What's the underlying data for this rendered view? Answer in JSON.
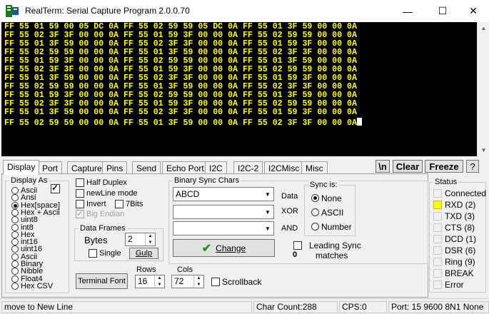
{
  "window": {
    "title": "RealTerm: Serial Capture Program 2.0.0.70",
    "minimize": "—",
    "maximize": "☐",
    "close": "✕"
  },
  "terminal": {
    "text_color": "#ffff00",
    "lines": [
      "FF 55 01 59 00 05 DC 0A FF 55 02 59 59 05 DC 0A FF 55 01 3F 59 00 00 0A",
      "FF 55 02 3F 3F 00 00 0A FF 55 01 59 3F 00 00 0A FF 55 02 59 59 00 00 0A",
      "FF 55 01 3F 59 00 00 0A FF 55 02 3F 3F 00 00 0A FF 55 01 59 3F 00 00 0A",
      "FF 55 02 59 59 00 00 0A FF 55 01 3F 59 00 00 0A FF 55 02 3F 3F 00 00 0A",
      "FF 55 01 59 3F 00 00 0A FF 55 02 59 59 00 00 0A FF 55 01 3F 59 00 00 0A",
      "FF 55 02 3F 3F 00 00 0A FF 55 01 59 3F 00 00 0A FF 55 02 59 59 00 00 0A",
      "FF 55 01 3F 59 00 00 0A FF 55 02 3F 3F 00 00 0A FF 55 01 59 3F 00 00 0A",
      "FF 55 02 59 59 00 00 0A FF 55 01 3F 59 00 00 0A FF 55 02 3F 3F 00 00 0A",
      "FF 55 01 59 3F 00 00 0A FF 55 02 59 59 00 00 0A FF 55 01 3F 59 00 00 0A",
      "FF 55 02 3F 3F 00 00 0A FF 55 01 59 3F 00 00 0A FF 55 02 59 59 00 00 0A",
      "FF 55 01 3F 59 00 00 0A FF 55 02 3F 3F 00 00 0A FF 55 01 59 3F 00 00 0A",
      "FF 55 02 59 59 00 00 0A FF 55 01 3F 59 00 00 0A FF 55 02 3F 3F 00 00 0A"
    ]
  },
  "tabs": [
    "Display",
    "Port",
    "Capture",
    "Pins",
    "Send",
    "Echo Port",
    "I2C",
    "I2C-2",
    "I2CMisc",
    "Misc"
  ],
  "toolbar": {
    "newline": "\\n",
    "clear": "Clear",
    "freeze": "Freeze",
    "help": "?"
  },
  "display_as": {
    "label": "Display As",
    "options": [
      "Ascii",
      "Ansi",
      "Hex[space]",
      "Hex + Ascii",
      "uint8",
      "int8",
      "Hex",
      "int16",
      "uint16",
      "Ascii",
      "Binary",
      "Nibble",
      "Float4",
      "Hex CSV"
    ],
    "selected": "Hex[space]"
  },
  "options": {
    "half_duplex": "Half Duplex",
    "newline_mode": "newLine mode",
    "invert": "Invert",
    "sevenbits": "7Bits",
    "big_endian": "Big Endian"
  },
  "data_frames": {
    "label": "Data Frames",
    "bytes_label": "Bytes",
    "bytes_value": "2",
    "single": "Single",
    "gulp": "Gulp"
  },
  "binary_sync": {
    "label": "Binary Sync Chars",
    "data_value": "ABCD",
    "data_label": "Data",
    "xor_label": "XOR",
    "and_label": "AND",
    "change": "Change",
    "leading_sync": "Leading Sync",
    "matches_count": "0",
    "matches": "matches"
  },
  "sync_is": {
    "label": "Sync is:",
    "options": [
      "None",
      "ASCII",
      "Number"
    ],
    "selected": "None"
  },
  "terminal_font": "Terminal Font",
  "rows": {
    "label": "Rows",
    "value": "16"
  },
  "cols": {
    "label": "Cols",
    "value": "72"
  },
  "scrollback": "Scrollback",
  "status": {
    "label": "Status",
    "items": [
      {
        "label": "Connected",
        "lit": false
      },
      {
        "label": "RXD (2)",
        "lit": true
      },
      {
        "label": "TXD (3)",
        "lit": false
      },
      {
        "label": "CTS (8)",
        "lit": false
      },
      {
        "label": "DCD (1)",
        "lit": false
      },
      {
        "label": "DSR (6)",
        "lit": false
      },
      {
        "label": "Ring (9)",
        "lit": false
      },
      {
        "label": "BREAK",
        "lit": false
      },
      {
        "label": "Error",
        "lit": false
      }
    ],
    "lit_color": "#ffff00"
  },
  "statusbar": {
    "hint": "move to New Line",
    "char_count": "Char Count:288",
    "cps": "CPS:0",
    "port": "Port: 15 9600 8N1 None"
  }
}
